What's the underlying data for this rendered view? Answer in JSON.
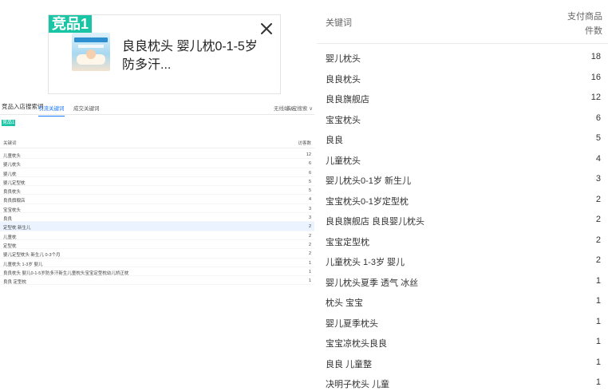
{
  "card": {
    "badge": "竞品1",
    "title": "良良枕头 婴儿枕0-1-5岁防多汗..."
  },
  "left_panel": {
    "title": "竞品入店搜索词",
    "tabs": [
      "引流关键词",
      "成交关键词"
    ],
    "filter1": "无线端 ∨",
    "filter2": "淘宝搜索 ∨",
    "badge": "竞品1",
    "col_keyword": "关键词",
    "col_value": "访客数",
    "rows": [
      {
        "k": "儿童枕头",
        "v": "12"
      },
      {
        "k": "婴儿枕头",
        "v": "6"
      },
      {
        "k": "婴儿枕",
        "v": "6"
      },
      {
        "k": "婴儿定型枕",
        "v": "5"
      },
      {
        "k": "良良枕头",
        "v": "5"
      },
      {
        "k": "良良旗舰店",
        "v": "4"
      },
      {
        "k": "宝宝枕头",
        "v": "3"
      },
      {
        "k": "良良",
        "v": "3"
      },
      {
        "k": "定型枕 新生儿",
        "v": "2"
      },
      {
        "k": "儿童枕",
        "v": "2"
      },
      {
        "k": "定型枕",
        "v": "2"
      },
      {
        "k": "婴儿定型枕头 新生儿 0-3个月",
        "v": "2"
      },
      {
        "k": "儿童枕头 1-3岁 婴儿",
        "v": "1"
      },
      {
        "k": "良良枕头 婴儿0-1-5岁防多汗新生儿童枕头宝宝定型枕幼儿矫正枕",
        "v": "1"
      },
      {
        "k": "良良 定型枕",
        "v": "1"
      }
    ]
  },
  "right_table": {
    "col_keyword": "关键词",
    "col_value_line1": "支付商品",
    "col_value_line2": "件数",
    "rows": [
      {
        "k": "婴儿枕头",
        "v": "18"
      },
      {
        "k": "良良枕头",
        "v": "16"
      },
      {
        "k": "良良旗舰店",
        "v": "12"
      },
      {
        "k": "宝宝枕头",
        "v": "6"
      },
      {
        "k": "良良",
        "v": "5"
      },
      {
        "k": "儿童枕头",
        "v": "4"
      },
      {
        "k": "婴儿枕头0-1岁 新生儿",
        "v": "3"
      },
      {
        "k": "宝宝枕头0-1岁定型枕",
        "v": "2"
      },
      {
        "k": "良良旗舰店 良良婴儿枕头",
        "v": "2"
      },
      {
        "k": "宝宝定型枕",
        "v": "2"
      },
      {
        "k": "儿童枕头 1-3岁 婴儿",
        "v": "2"
      },
      {
        "k": "婴儿枕头夏季 透气 冰丝",
        "v": "1"
      },
      {
        "k": "枕头 宝宝",
        "v": "1"
      },
      {
        "k": "婴儿夏季枕头",
        "v": "1"
      },
      {
        "k": "宝宝凉枕头良良",
        "v": "1"
      },
      {
        "k": "良良 儿童整",
        "v": "1"
      },
      {
        "k": "决明子枕头 儿童",
        "v": "1"
      }
    ]
  },
  "icons": {
    "close": "close-icon",
    "product": "product-thumbnail"
  },
  "colors": {
    "badge": "#1ac5a6",
    "tab_active": "#1677ff"
  }
}
